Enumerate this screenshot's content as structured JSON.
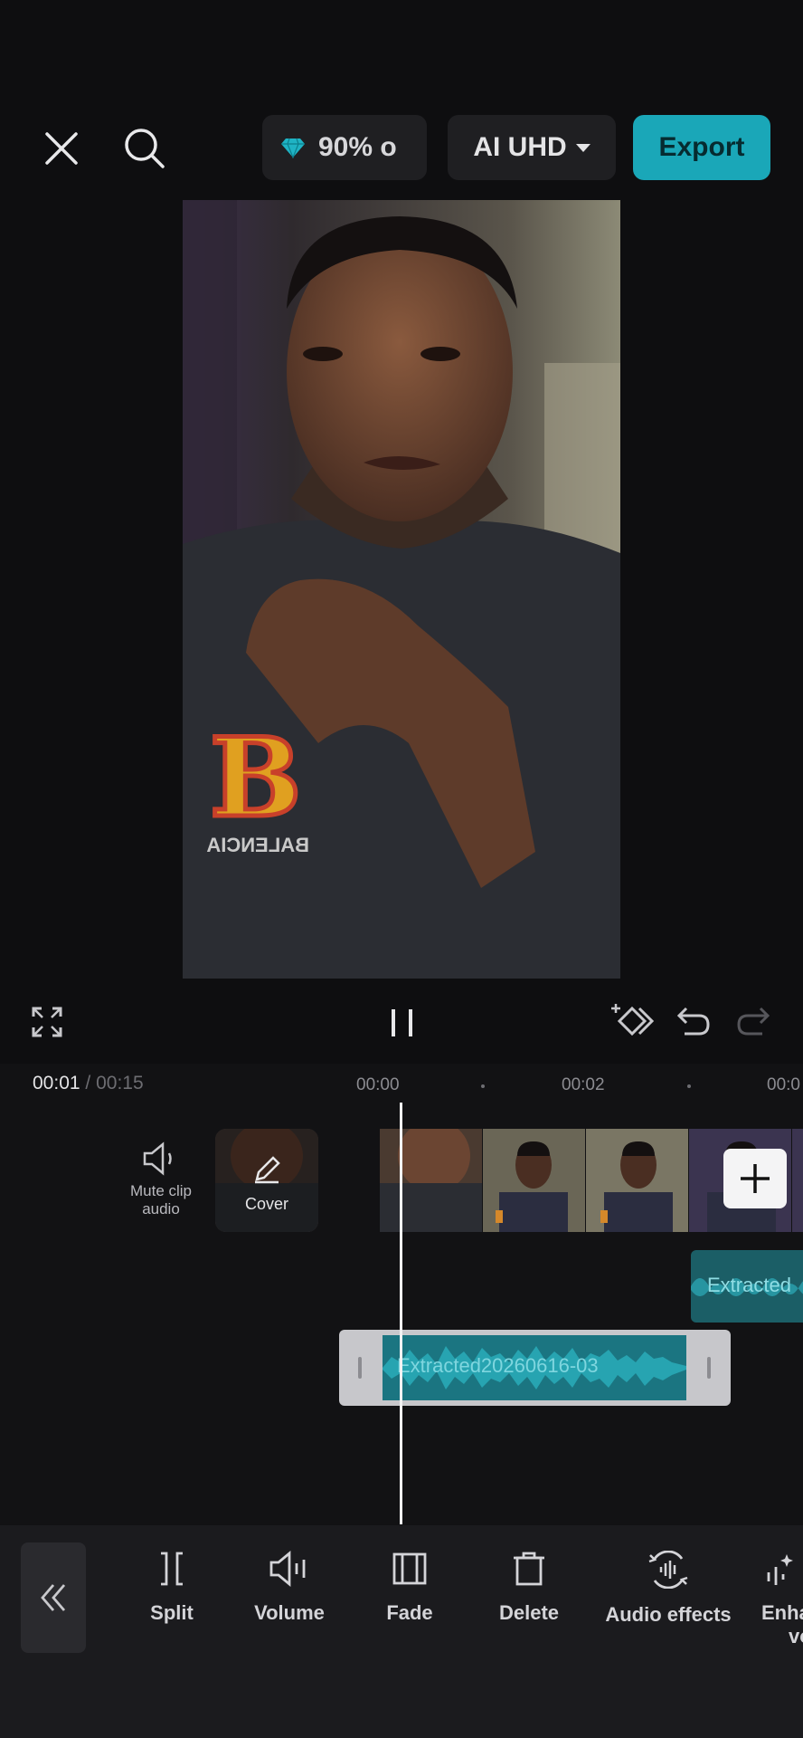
{
  "header": {
    "credits_text": "90% o",
    "quality_label": "AI UHD",
    "export_label": "Export"
  },
  "timeline": {
    "current_time": "00:01",
    "separator": "/",
    "total_time": "00:15",
    "ruler_labels": [
      "00:00",
      "00:02",
      "00:0"
    ],
    "mute_label": "Mute clip\naudio",
    "cover_label": "Cover",
    "audio_clip_label": "Extracted20260616-03",
    "audio_clip_2_label": "Extracted"
  },
  "preview": {
    "shirt_text": "BALENCIA"
  },
  "toolbar": {
    "items": [
      {
        "label": "Split",
        "icon": "split-icon"
      },
      {
        "label": "Volume",
        "icon": "volume-icon"
      },
      {
        "label": "Fade",
        "icon": "fade-icon"
      },
      {
        "label": "Delete",
        "icon": "delete-icon"
      },
      {
        "label": "Audio effects",
        "icon": "audio-effects-icon"
      },
      {
        "label": "Enha",
        "label2": "vo",
        "icon": "enhance-voice-icon"
      }
    ]
  },
  "colors": {
    "accent": "#1aa7b8",
    "background": "#0e0e10",
    "audio_clip": "#1b7581"
  }
}
